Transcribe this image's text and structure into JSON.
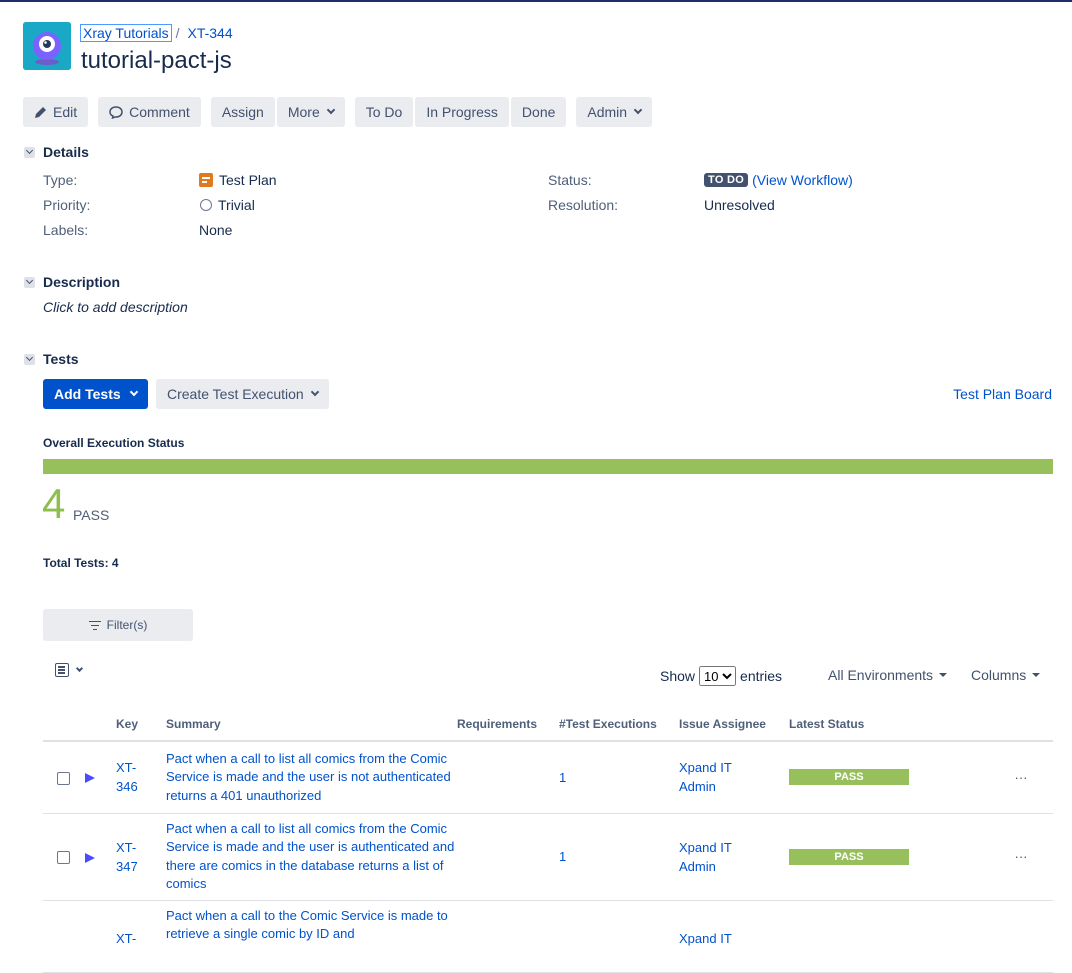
{
  "header": {
    "project": "Xray Tutorials",
    "separator": "/",
    "issue_key": "XT-344",
    "title": "tutorial-pact-js"
  },
  "toolbar": {
    "edit": "Edit",
    "comment": "Comment",
    "assign": "Assign",
    "more": "More",
    "todo": "To Do",
    "in_progress": "In Progress",
    "done": "Done",
    "admin": "Admin"
  },
  "details": {
    "heading": "Details",
    "type_label": "Type:",
    "type_value": "Test Plan",
    "priority_label": "Priority:",
    "priority_value": "Trivial",
    "labels_label": "Labels:",
    "labels_value": "None",
    "status_label": "Status:",
    "status_value": "TO DO",
    "view_workflow": "(View Workflow)",
    "resolution_label": "Resolution:",
    "resolution_value": "Unresolved"
  },
  "description": {
    "heading": "Description",
    "placeholder": "Click to add description"
  },
  "tests": {
    "heading": "Tests",
    "add_tests": "Add Tests",
    "create_execution": "Create Test Execution",
    "plan_board": "Test Plan Board",
    "overall_label": "Overall Execution Status",
    "pass_fraction": 1.0,
    "pass_count": "4",
    "pass_label": "PASS",
    "total_tests": "Total Tests: 4",
    "filter": "Filter(s)",
    "show": "Show",
    "entries_value": "10",
    "entries": "entries",
    "environments": "All Environments",
    "columns": "Columns",
    "headers": {
      "key": "Key",
      "summary": "Summary",
      "requirements": "Requirements",
      "executions": "#Test Executions",
      "assignee": "Issue Assignee",
      "latest_status": "Latest Status"
    },
    "rows": [
      {
        "key_line1": "XT-",
        "key_line2": "346",
        "summary": "Pact when a call to list all comics from the Comic Service is made and the user is not authenticated returns a 401 unauthorized",
        "requirements": "",
        "executions": "1",
        "assignee_line1": "Xpand IT",
        "assignee_line2": "Admin",
        "status": "PASS"
      },
      {
        "key_line1": "XT-",
        "key_line2": "347",
        "summary": "Pact when a call to list all comics from the Comic Service is made and the user is authenticated and there are comics in the database returns a list of comics",
        "requirements": "",
        "executions": "1",
        "assignee_line1": "Xpand IT",
        "assignee_line2": "Admin",
        "status": "PASS"
      },
      {
        "key_line1": "XT-",
        "key_line2": "",
        "summary": "Pact when a call to the Comic Service is made to retrieve a single comic by ID and",
        "requirements": "",
        "executions": "",
        "assignee_line1": "Xpand IT",
        "assignee_line2": "",
        "status": ""
      }
    ]
  },
  "colors": {
    "link": "#0052CC",
    "pass": "#97C05C",
    "primary": "#0052CC",
    "status_todo": "#42526E"
  },
  "icons": [
    "project-avatar-icon",
    "edit-icon",
    "comment-icon",
    "chevron-down-icon",
    "test-plan-icon",
    "trivial-priority-icon",
    "filter-icon",
    "list-view-icon",
    "play-icon",
    "more-actions-icon"
  ]
}
